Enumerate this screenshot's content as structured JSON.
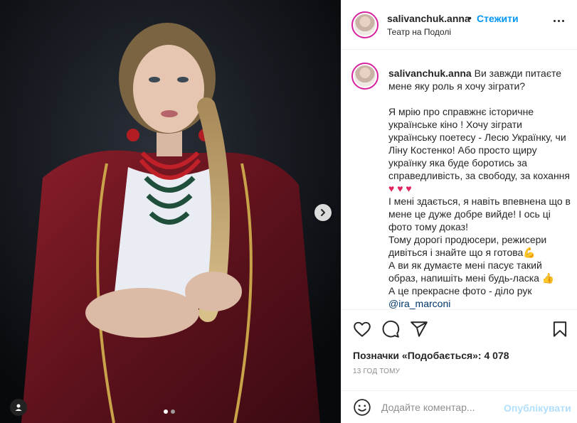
{
  "post": {
    "username": "salivanchuk.anna",
    "separator": "•",
    "follow_label": "Стежити",
    "location": "Театр на Подолі"
  },
  "caption": {
    "username": "salivanchuk.anna",
    "lead": "Ви завжди питаєте мене яку роль я хочу зіграти?",
    "p1": "Я мрію про справжнє історичне українське кіно ! Хочу зіграти українську поетесу - Лесю Українку, чи Ліну Костенко! Або просто щиру українку яка буде боротись за справедливість, за свободу, за кохання",
    "hearts": "♥ ♥ ♥",
    "p2": "І мені здається, я навіть впевнена що в мене це дуже добре вийде! І ось ці фото тому доказ!",
    "p3": "Тому дорогі продюсери, режисери дивіться і знайте що я готова💪",
    "p4": "А ви як думаєте мені пасує такий образ, напишіть мені будь-ласка 👍",
    "p5": "А це прекрасне фото - діло рук",
    "mention": "@ira_marconi"
  },
  "stats": {
    "likes": "Позначки «Подобається»: 4 078",
    "time": "13 ГОД ТОМУ"
  },
  "comment": {
    "placeholder": "Додайте коментар...",
    "publish_label": "Опублікувати"
  },
  "carousel": {
    "current": 1,
    "total": 2
  },
  "icons": {
    "more": "more-options-icon",
    "like": "heart-icon",
    "comment": "comment-icon",
    "share": "send-icon",
    "save": "bookmark-icon",
    "emoji": "emoji-icon",
    "next": "chevron-right-icon",
    "tags": "user-tag-icon"
  },
  "colors": {
    "accent": "#0095f6",
    "mention": "#00376b",
    "publish_disabled": "#b2dffc",
    "muted": "#8e8e8e"
  }
}
